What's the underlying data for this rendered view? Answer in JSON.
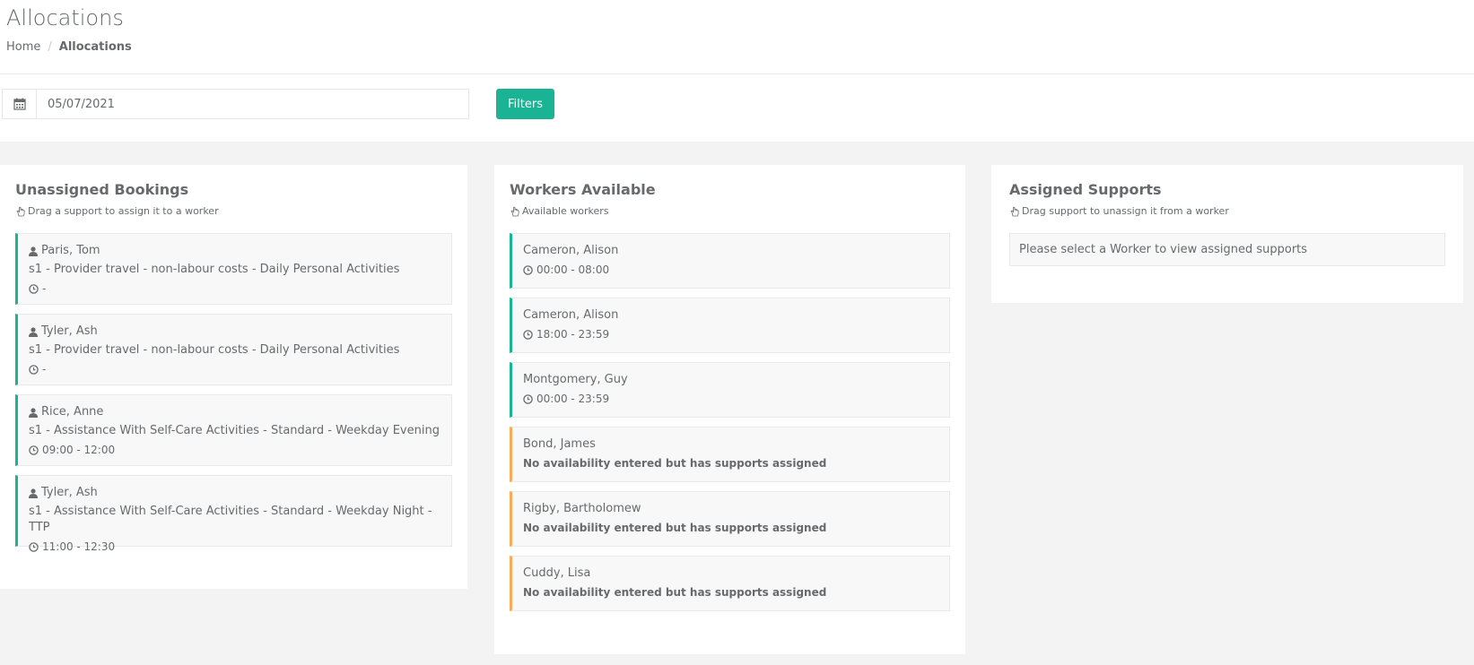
{
  "header": {
    "title": "Allocations",
    "breadcrumb": {
      "home": "Home",
      "current": "Allocations"
    }
  },
  "toolbar": {
    "date_value": "05/07/2021",
    "filters_label": "Filters"
  },
  "unassigned": {
    "title": "Unassigned Bookings",
    "hint": "Drag a support to assign it to a worker",
    "items": [
      {
        "name": "Paris, Tom",
        "service": "s1 - Provider travel - non-labour costs - Daily Personal Activities",
        "time": "-"
      },
      {
        "name": "Tyler, Ash",
        "service": "s1 - Provider travel - non-labour costs - Daily Personal Activities",
        "time": "-"
      },
      {
        "name": "Rice, Anne",
        "service": "s1 - Assistance With Self-Care Activities - Standard - Weekday Evening",
        "time": "09:00 - 12:00"
      },
      {
        "name": "Tyler, Ash",
        "service": "s1 - Assistance With Self-Care Activities - Standard - Weekday Night - TTP",
        "time": "11:00 - 12:30"
      }
    ]
  },
  "workers": {
    "title": "Workers Available",
    "hint": "Available workers",
    "items": [
      {
        "name": "Cameron, Alison",
        "detail": "00:00 - 08:00",
        "status": "available"
      },
      {
        "name": "Cameron, Alison",
        "detail": "18:00 - 23:59",
        "status": "available"
      },
      {
        "name": "Montgomery, Guy",
        "detail": "00:00 - 23:59",
        "status": "available"
      },
      {
        "name": "Bond, James",
        "detail": "No availability entered but has supports assigned",
        "status": "warning"
      },
      {
        "name": "Rigby, Bartholomew",
        "detail": "No availability entered but has supports assigned",
        "status": "warning"
      },
      {
        "name": "Cuddy, Lisa",
        "detail": "No availability entered but has supports assigned",
        "status": "warning"
      }
    ]
  },
  "assigned": {
    "title": "Assigned Supports",
    "hint": "Drag support to unassign it from a worker",
    "empty_message": "Please select a Worker to view assigned supports"
  },
  "colors": {
    "primary": "#1ab394",
    "warning": "#f8ac59",
    "text": "#676a6c",
    "background": "#f3f3f4"
  }
}
